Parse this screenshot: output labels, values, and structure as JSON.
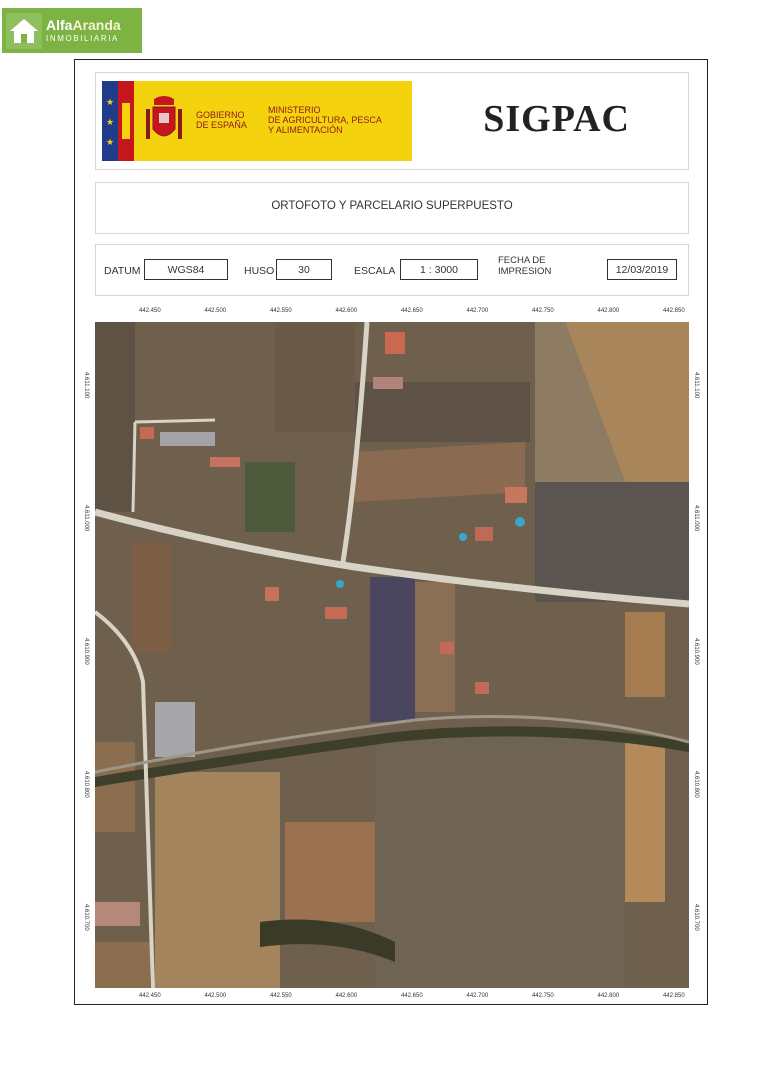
{
  "logo": {
    "brand_part1": "Alfa",
    "brand_part2": "Aranda",
    "subtitle": "INMOBILIARIA"
  },
  "header": {
    "gobierno_line1": "GOBIERNO",
    "gobierno_line2": "DE ESPAÑA",
    "ministerio_line1": "MINISTERIO",
    "ministerio_line2": "DE AGRICULTURA, PESCA",
    "ministerio_line3": "Y ALIMENTACIÓN",
    "title": "SIGPAC"
  },
  "subtitle": "ORTOFOTO Y PARCELARIO SUPERPUESTO",
  "info": {
    "datum_label": "DATUM",
    "datum_value": "WGS84",
    "huso_label": "HUSO",
    "huso_value": "30",
    "escala_label": "ESCALA",
    "escala_value": "1 : 3000",
    "fecha_label_line1": "FECHA DE",
    "fecha_label_line2": "IMPRESION",
    "fecha_value": "12/03/2019"
  },
  "map": {
    "x_ticks": [
      "442.450",
      "442.500",
      "442.550",
      "442.600",
      "442.650",
      "442.700",
      "442.750",
      "442.800",
      "442.850"
    ],
    "y_ticks": [
      "4.611.100",
      "4.611.000",
      "4.610.900",
      "4.610.800",
      "4.610.700"
    ]
  },
  "colors": {
    "logo_green": "#7cb342",
    "gov_yellow": "#f5d20e",
    "gov_text": "#8a1a1a",
    "flag_red": "#c4161c",
    "flag_blue": "#1f3b8c"
  }
}
